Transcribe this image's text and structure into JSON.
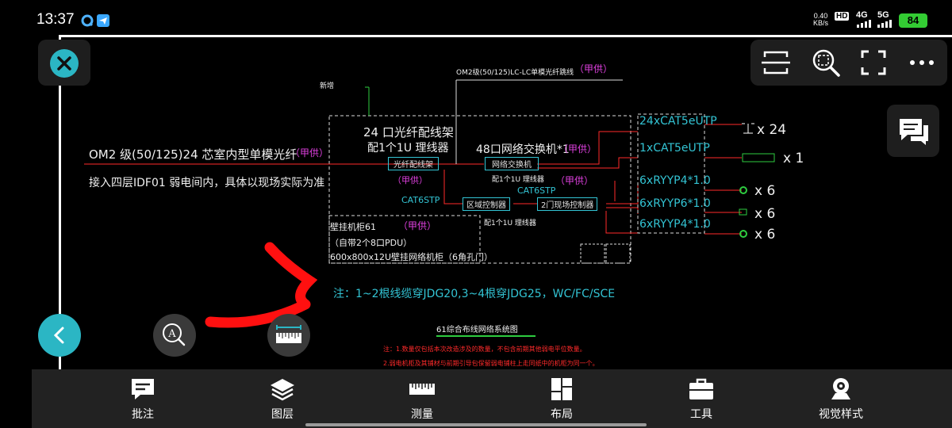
{
  "status_bar": {
    "time": "13:37",
    "net_speed_value": "0.40",
    "net_speed_unit": "KB/s",
    "hd_badge": "HD",
    "signal_1": "4G",
    "signal_2": "5G",
    "battery": "84"
  },
  "toolbar": {
    "icons": [
      "crop-frame-icon",
      "zoom-search-icon",
      "fullscreen-icon",
      "more-icon"
    ]
  },
  "drawing": {
    "top_fiber_label": "OM2级(50/125)LC-LC单模光纤跳线",
    "top_jia_gong": "（甲供）",
    "small_top_left": "新增",
    "fiber_frame_title_1": "24 口光纤配线架",
    "fiber_frame_title_2": "配1个1U 理线器",
    "switch_title": "48口网络交换机*1",
    "switch_jia": "（甲供）",
    "fiber_box_label": "光纤配线架",
    "fiber_box_jia": "（甲供）",
    "switch_box_label": "网络交换机",
    "switch_box_sub": "配1个1U 理线器",
    "switch_box_jia": "（甲供）",
    "cat6_left": "CAT6STP",
    "cat6_right": "CAT6STP",
    "area_controller": "区域控制器",
    "door_controller": "2门现场控制器",
    "door_sub": "配1个1U 理线器",
    "om2_main": "OM2 级(50/125)24 芯室内型单模光纤",
    "om2_jia": "（甲供）",
    "idf_note": "接入四层IDF01 弱电间内，具体以现场实际为准",
    "cabinet_line1": "壁挂机柜61",
    "cabinet_jia": "（甲供）",
    "cabinet_line2": "（自带2个8口PDU）",
    "cabinet_line3": "600x800x12U壁挂网络机柜（6角孔门）",
    "cable_1": "24xCAT5eUTP",
    "cable_2": "1xCAT5eUTP",
    "cable_3": "6xRYYP4*1.0",
    "cable_4": "6xRYYP6*1.0",
    "cable_5": "6xRYYP4*1.0",
    "qty_1": "x 24",
    "qty_2": "x 1",
    "qty_3": "x 6",
    "qty_4": "x 6",
    "qty_5": "x 6",
    "note_main": "注：1~2根线缆穿JDG20,3~4根穿JDG25，WC/FC/SCE",
    "diagram_title": "61综合布线网络系统图",
    "red_note_1": "注：1.数量仅包括本次改造涉及的数量，不包含前期其他弱电平位数量。",
    "red_note_2": "2.弱电机柜及其铺材与前期引导包保留弱电铺柱上走同纸中的机柜为同一个。"
  },
  "bottom_nav": {
    "items": [
      {
        "label": "批注",
        "icon": "annotation-icon"
      },
      {
        "label": "图层",
        "icon": "layers-icon"
      },
      {
        "label": "测量",
        "icon": "ruler-icon"
      },
      {
        "label": "布局",
        "icon": "layout-icon"
      },
      {
        "label": "工具",
        "icon": "toolbox-icon"
      },
      {
        "label": "视觉样式",
        "icon": "visual-style-icon"
      }
    ]
  },
  "colors": {
    "accent": "#2bb6c4",
    "battery": "#33cc33",
    "cad_red": "#ff2a2a",
    "cad_magenta": "#e040e0",
    "cad_cyan": "#33c4d4",
    "cad_green": "#2ecc40"
  }
}
